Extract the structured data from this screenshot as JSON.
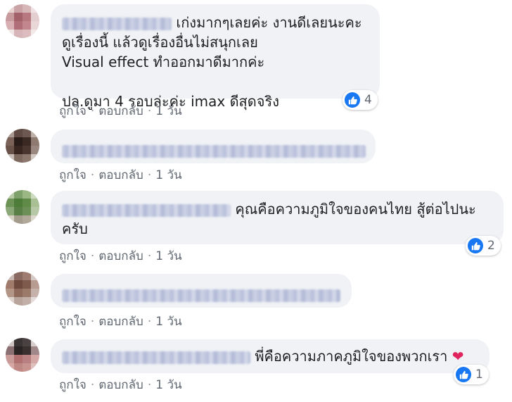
{
  "actions": {
    "like": "ถูกใจ",
    "reply": "ตอบกลับ",
    "separator": "·"
  },
  "comments": [
    {
      "text": "เก่งมากๆเลยค่ะ งานดีเลยนะคะ\nดูเรื่องนี้ แล้วดูเรื่องอื่นไม่สนุกเลย\nVisual effect ทำออกมาดีมากค่ะ\n\nปล.ดูมา 4 รอบล่ะค่ะ imax ดีสุดจริง",
      "reaction_count": "4",
      "time": "1 วัน",
      "avatar_colors": [
        "#e8d2d2",
        "#c9a3a6",
        "#d7b6b8",
        "#f0e2e2",
        "#c79b9e",
        "#a3626a",
        "#b77880",
        "#e4cfd0",
        "#d8b0b4",
        "#b06e78",
        "#c2868e",
        "#e9d6d7",
        "#f1e5e5",
        "#d6b4b7",
        "#dcbcbf",
        "#f3e9e9"
      ]
    },
    {
      "text": "",
      "reaction_count": "",
      "time": "1 วัน",
      "avatar_colors": [
        "#a89a92",
        "#5e4a42",
        "#6c5850",
        "#bdb0a8",
        "#7a6258",
        "#2a1c18",
        "#3b2a24",
        "#8e7a70",
        "#6a544a",
        "#3a2620",
        "#4a362e",
        "#9a8880",
        "#c7bcb5",
        "#7f6a60",
        "#8b776c",
        "#d2c8c2"
      ]
    },
    {
      "text": "คุณคือความภูมิใจของคนไทย สู้ต่อไปนะ\nครับ",
      "reaction_count": "2",
      "time": "1 วัน",
      "avatar_colors": [
        "#b8c9a8",
        "#7ea06a",
        "#9bb784",
        "#cddbc0",
        "#6d9456",
        "#4e7d3a",
        "#5f8a48",
        "#a9c095",
        "#8aa878",
        "#5a7f46",
        "#6b8f56",
        "#b6c8a6",
        "#d6d2c6",
        "#a49c8c",
        "#b0a898",
        "#dcd8ce"
      ]
    },
    {
      "text": "",
      "reaction_count": "",
      "time": "1 วัน",
      "avatar_colors": [
        "#c8b8b4",
        "#8a6a60",
        "#9e7c70",
        "#d6cac6",
        "#a07a6a",
        "#6e4a3e",
        "#7d5a4c",
        "#b89c92",
        "#b49686",
        "#8e6a5a",
        "#9c7a6a",
        "#c6b2aa",
        "#ddd2ce",
        "#b9a49c",
        "#c2afa8",
        "#e4dcd8"
      ]
    },
    {
      "text": "พี่คือความภาคภูมิใจของพวกเรา",
      "reaction_count": "1",
      "time": "1 วัน",
      "avatar_colors": [
        "#cfc4c4",
        "#3a3434",
        "#4a4242",
        "#d8cece",
        "#8a7070",
        "#2a2424",
        "#3a3030",
        "#a08888",
        "#c89a98",
        "#b07070",
        "#b88080",
        "#d4a8a6",
        "#d6a8a4",
        "#c08884",
        "#c89490",
        "#e0c0bc"
      ]
    }
  ],
  "colors": {
    "like_blue": "#1877f2",
    "heart": "#e0245e",
    "bubble_bg": "#f0f2f5",
    "meta_text": "#606770"
  },
  "icons": {
    "like": "thumbs-up-icon",
    "love": "heart-icon"
  }
}
